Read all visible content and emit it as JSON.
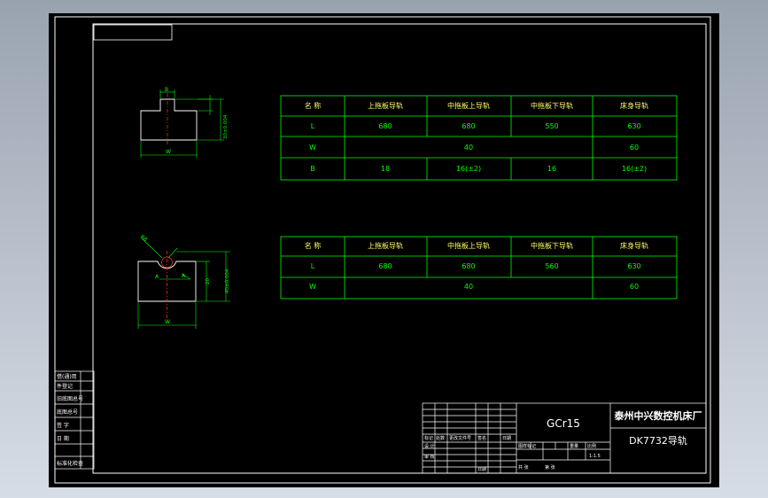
{
  "colors": {
    "background": "#000000",
    "frame": "#ffffff",
    "table_line": "#00ff00",
    "header_text": "#ffff66",
    "dimension": "#00ff00",
    "centerline": "#ff3030"
  },
  "table1": {
    "header": [
      "名 称",
      "上拖板导轨",
      "中拖板上导轨",
      "中拖板下导轨",
      "床身导轨"
    ],
    "row_L": [
      "L",
      "680",
      "680",
      "550",
      "630"
    ],
    "row_W": [
      "W",
      "40",
      "60"
    ],
    "row_B": [
      "B",
      "18",
      "16(±2)",
      "16",
      "16(±2)"
    ]
  },
  "table2": {
    "header": [
      "名 称",
      "上拖板导轨",
      "中拖板上导轨",
      "中拖板下导轨",
      "床身导轨"
    ],
    "row_L": [
      "L",
      "680",
      "680",
      "560",
      "630"
    ],
    "row_W": [
      "W",
      "40",
      "60"
    ]
  },
  "fig1": {
    "dim_top": "B",
    "dim_bottom": "W",
    "dim_right": "30±0.004"
  },
  "fig2": {
    "dim_radius": "R8",
    "dim_inner": "A",
    "dim_height": "20",
    "dim_right": "40±0.004",
    "dim_bottom": "W"
  },
  "left_strip": [
    "借(通)用",
    "件登记",
    "旧底图总号",
    "底图总号",
    "签 字",
    "日 期",
    "标准化检查"
  ],
  "title_block": {
    "material": "GCr15",
    "company": "泰州中兴数控机床厂",
    "drawing_name": "DK7732导轨",
    "scale": "1:1.5",
    "labels": [
      "标记",
      "处数",
      "更改文件号",
      "签名",
      "日期",
      "设 计",
      "图样标记",
      "重量",
      "比例",
      "共 张",
      "第 张",
      "审 核",
      "日期"
    ]
  }
}
